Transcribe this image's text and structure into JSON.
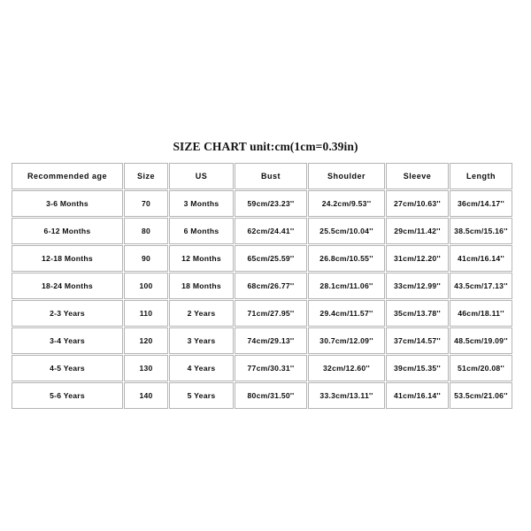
{
  "title": "SIZE CHART unit:cm(1cm=0.39in)",
  "table": {
    "headers": [
      "Recommended age",
      "Size",
      "US",
      "Bust",
      "Shoulder",
      "Sleeve",
      "Length"
    ],
    "rows": [
      [
        "3-6 Months",
        "70",
        "3 Months",
        "59cm/23.23''",
        "24.2cm/9.53''",
        "27cm/10.63''",
        "36cm/14.17''"
      ],
      [
        "6-12 Months",
        "80",
        "6 Months",
        "62cm/24.41''",
        "25.5cm/10.04''",
        "29cm/11.42''",
        "38.5cm/15.16''"
      ],
      [
        "12-18 Months",
        "90",
        "12 Months",
        "65cm/25.59''",
        "26.8cm/10.55''",
        "31cm/12.20''",
        "41cm/16.14''"
      ],
      [
        "18-24 Months",
        "100",
        "18 Months",
        "68cm/26.77''",
        "28.1cm/11.06''",
        "33cm/12.99''",
        "43.5cm/17.13''"
      ],
      [
        "2-3 Years",
        "110",
        "2 Years",
        "71cm/27.95''",
        "29.4cm/11.57''",
        "35cm/13.78''",
        "46cm/18.11''"
      ],
      [
        "3-4 Years",
        "120",
        "3 Years",
        "74cm/29.13''",
        "30.7cm/12.09''",
        "37cm/14.57''",
        "48.5cm/19.09''"
      ],
      [
        "4-5 Years",
        "130",
        "4 Years",
        "77cm/30.31''",
        "32cm/12.60''",
        "39cm/15.35''",
        "51cm/20.08''"
      ],
      [
        "5-6 Years",
        "140",
        "5 Years",
        "80cm/31.50''",
        "33.3cm/13.11''",
        "41cm/16.14''",
        "53.5cm/21.06''"
      ]
    ]
  },
  "colors": {
    "background": "#ffffff",
    "text": "#0d0d0d",
    "border": "#b4b4b4"
  }
}
